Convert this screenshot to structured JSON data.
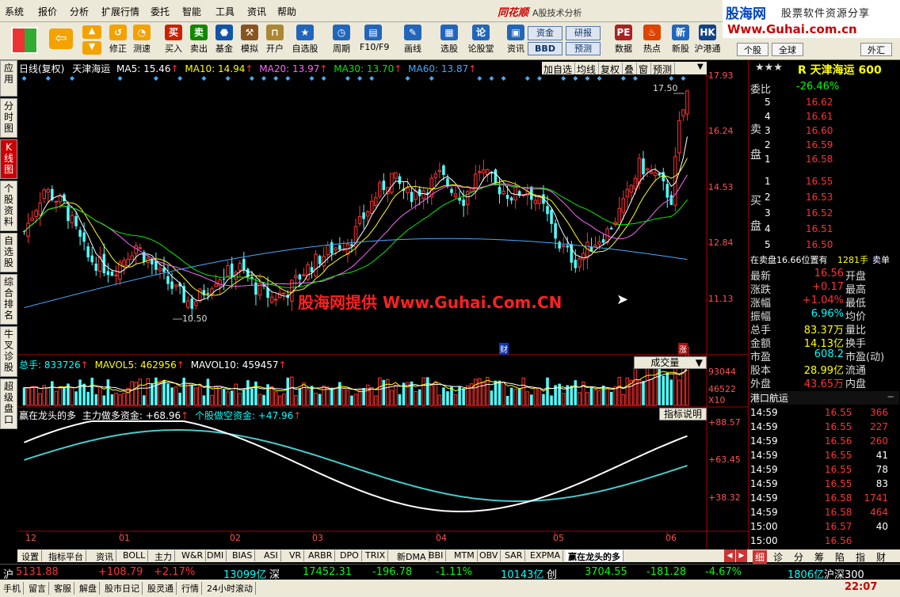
{
  "menu": [
    "系统",
    "报价",
    "分析",
    "扩展行情",
    "委托",
    "智能",
    "工具",
    "资讯",
    "帮助"
  ],
  "brand": "同花顺",
  "app_title": "A股技术分析",
  "watermark_logo": {
    "line1": "股海网",
    "line2": "股票软件资源分享",
    "url": "Www.Guhai.com.cn"
  },
  "toolbar": [
    {
      "label": "买入",
      "icon": "buy-icon",
      "glyph": "买",
      "color": "#cc2200"
    },
    {
      "label": "卖出",
      "icon": "sell-icon",
      "glyph": "卖",
      "color": "#118800"
    },
    {
      "label": "基金",
      "icon": "fund-icon",
      "glyph": "⬣",
      "color": "#1155aa"
    },
    {
      "label": "模拟",
      "icon": "hammer-icon",
      "glyph": "⚒",
      "color": "#885522"
    },
    {
      "label": "开户",
      "icon": "lock-icon",
      "glyph": "⊓",
      "color": "#aa8833"
    },
    {
      "label": "自选股",
      "icon": "star-icon",
      "glyph": "★",
      "color": "#2266bb"
    },
    {
      "label": "周期",
      "icon": "clock-icon",
      "glyph": "◷",
      "color": "#2266bb"
    },
    {
      "label": "F10/F9",
      "icon": "f10-icon",
      "glyph": "▤",
      "color": "#2266bb"
    },
    {
      "label": "画线",
      "icon": "pen-icon",
      "glyph": "✎",
      "color": "#2266bb"
    },
    {
      "label": "选股",
      "icon": "screen-icon",
      "glyph": "▦",
      "color": "#2266bb"
    },
    {
      "label": "论股堂",
      "icon": "forum-icon",
      "glyph": "论",
      "color": "#2266bb"
    },
    {
      "label": "资讯",
      "icon": "news-icon",
      "glyph": "▣",
      "color": "#2266bb"
    },
    {
      "label": "数据",
      "icon": "pe-icon",
      "glyph": "PE",
      "color": "#aa2222"
    },
    {
      "label": "热点",
      "icon": "hot-icon",
      "glyph": "♨",
      "color": "#dd4400"
    },
    {
      "label": "新股",
      "icon": "new-icon",
      "glyph": "新",
      "color": "#2266bb"
    },
    {
      "label": "沪港通",
      "icon": "hk-icon",
      "glyph": "HK",
      "color": "#114488"
    }
  ],
  "toolbar_extra": {
    "back_label": "",
    "up_label": "",
    "fix_label": "修正",
    "test_label": "测速",
    "fund_btn": "资金",
    "bbd_btn": "BBD",
    "research_btn": "研报",
    "forecast_btn": "预测",
    "tab_single": "个股",
    "tab_global": "全球",
    "tab_fx": "外汇"
  },
  "left_tabs": [
    "应用",
    "分时图",
    "K线图",
    "个股资料",
    "自选股",
    "综合排名",
    "牛叉诊股",
    "超级盘口"
  ],
  "chart_header": {
    "period": "日线(复权)",
    "stock": "天津海运",
    "ma5": "MA5: 15.46",
    "ma10": "MA10: 14.94",
    "ma20": "MA20: 13.97",
    "ma30": "MA30: 13.70",
    "ma60": "MA60: 13.87"
  },
  "chart_buttons": [
    "加自选",
    "均线",
    "复权",
    "叠",
    "窗",
    "预测"
  ],
  "price_axis": [
    "17.93",
    "16.24",
    "14.53",
    "12.84",
    "11.13"
  ],
  "price_marks": {
    "high": "17.50",
    "low": "10.50",
    "fin": "财",
    "up": "涨"
  },
  "watermark": "股海网提供 Www.Guhai.Com.CN",
  "vol_header": {
    "total": "总手: 833726",
    "mavol5": "MAVOL5: 462956",
    "mavol10": "MAVOL10: 459457",
    "dropdown": "成交量"
  },
  "vol_axis": [
    "93044",
    "46522",
    "X10"
  ],
  "ind_header": {
    "name": "赢在龙头的多",
    "main": "主力做多资金: +68.96",
    "retail": "个股做空资金: +47.96",
    "help": "指标说明"
  },
  "ind_axis": [
    "+88.57",
    "+63.45",
    "+38.32"
  ],
  "month_labels": [
    "12",
    "01",
    "02",
    "03",
    "04",
    "05",
    "06"
  ],
  "bottom_tabs": [
    "设置",
    "指标平台",
    "资讯",
    "BOLL",
    "主力",
    "W&R",
    "DMI",
    "BIAS",
    "ASI",
    "VR",
    "ARBR",
    "DPO",
    "TRIX",
    "新DMA",
    "BBI",
    "MTM",
    "OBV",
    "SAR",
    "EXPMA",
    "赢在龙头的多"
  ],
  "right_mini_tabs": [
    "细",
    "诊",
    "分",
    "筹",
    "陷",
    "指",
    "财"
  ],
  "quote": {
    "title": "天津海运",
    "code": "600",
    "ratio_label": "委比",
    "ratio": "-26.46%",
    "sell": [
      {
        "n": "5",
        "p": "16.62"
      },
      {
        "n": "4",
        "p": "16.61"
      },
      {
        "n": "3",
        "p": "16.60"
      },
      {
        "n": "2",
        "p": "16.59"
      },
      {
        "n": "1",
        "p": "16.58"
      }
    ],
    "buy": [
      {
        "n": "1",
        "p": "16.55"
      },
      {
        "n": "2",
        "p": "16.53"
      },
      {
        "n": "3",
        "p": "16.52"
      },
      {
        "n": "4",
        "p": "16.51"
      },
      {
        "n": "5",
        "p": "16.50"
      }
    ],
    "sell_label": "卖盘",
    "buy_label": "买盘",
    "onsell": "在卖盘16.66位置有",
    "onsell_vol": "1281手",
    "onsell_tail": "卖单",
    "fields": [
      {
        "k": "最新",
        "v": "16.56",
        "k2": "开盘"
      },
      {
        "k": "涨跌",
        "v": "+0.17",
        "k2": "最高"
      },
      {
        "k": "涨幅",
        "v": "+1.04%",
        "k2": "最低"
      },
      {
        "k": "振幅",
        "v": "6.96%",
        "k2": "均价"
      },
      {
        "k": "总手",
        "v": "83.37万",
        "k2": "量比"
      },
      {
        "k": "金额",
        "v": "14.13亿",
        "k2": "换手"
      },
      {
        "k": "市盈",
        "v": "608.2",
        "k2": "市盈(动)"
      },
      {
        "k": "股本",
        "v": "28.99亿",
        "k2": "流通"
      },
      {
        "k": "外盘",
        "v": "43.65万",
        "k2": "内盘"
      }
    ],
    "ticks_title": "港口航运",
    "ticks": [
      {
        "t": "14:59",
        "p": "16.55",
        "v": "366"
      },
      {
        "t": "14:59",
        "p": "16.55",
        "v": "227"
      },
      {
        "t": "14:59",
        "p": "16.56",
        "v": "260"
      },
      {
        "t": "14:59",
        "p": "16.55",
        "v": "41"
      },
      {
        "t": "14:59",
        "p": "16.55",
        "v": "78"
      },
      {
        "t": "14:59",
        "p": "16.55",
        "v": "83"
      },
      {
        "t": "14:59",
        "p": "16.58",
        "v": "1741"
      },
      {
        "t": "14:59",
        "p": "16.58",
        "v": "464"
      },
      {
        "t": "15:00",
        "p": "16.57",
        "v": "40"
      },
      {
        "t": "15:00",
        "p": "16.56",
        "v": ""
      }
    ]
  },
  "status": {
    "sh": "沪",
    "sh_idx": "5131.88",
    "sh_chg": "+108.79",
    "sh_pct": "+2.17%",
    "sh_amt": "13099亿",
    "sz": "深",
    "sz_idx": "17452.31",
    "sz_chg": "-196.78",
    "sz_pct": "-1.11%",
    "sz_amt": "10143亿",
    "cy": "创",
    "cy_idx": "3704.55",
    "cy_chg": "-181.28",
    "cy_pct": "-4.67%",
    "hs_amt": "1806亿",
    "hs": "沪深300"
  },
  "status2": [
    "手机",
    "留言",
    "客服",
    "解盘",
    "股市日记",
    "股灵通",
    "行情",
    "24小时滚动"
  ],
  "clock": "22:07"
}
